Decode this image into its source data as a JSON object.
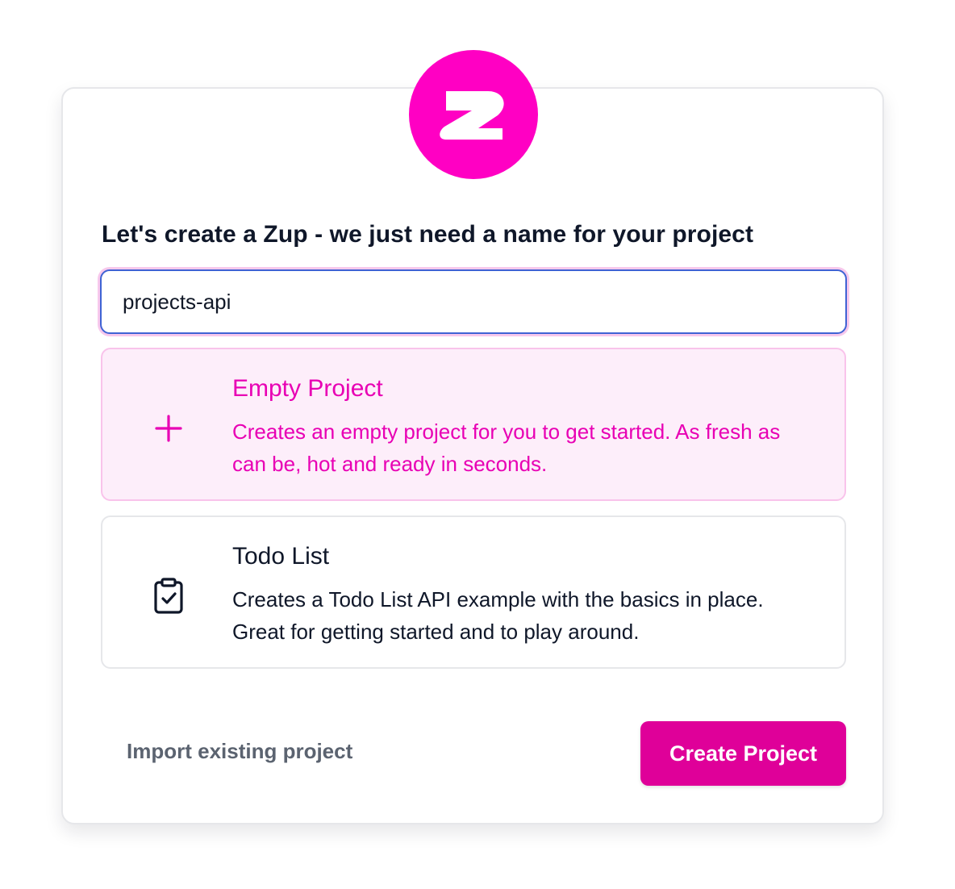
{
  "brand": {
    "logo_icon": "zuplo-z-logo-icon",
    "accent_color": "#ff00c3",
    "button_color": "#df0099"
  },
  "form": {
    "heading": "Let's create a Zup - we just need a name for your project",
    "project_name_value": "projects-api"
  },
  "templates": [
    {
      "icon": "plus-icon",
      "title": "Empty Project",
      "description": "Creates an empty project for you to get started. As fresh as can be, hot and ready in seconds.",
      "selected": true
    },
    {
      "icon": "clipboard-check-icon",
      "title": "Todo List",
      "description": "Creates a Todo List API example with the basics in place. Great for getting started and to play around.",
      "selected": false
    }
  ],
  "actions": {
    "import_label": "Import existing project",
    "create_label": "Create Project"
  }
}
